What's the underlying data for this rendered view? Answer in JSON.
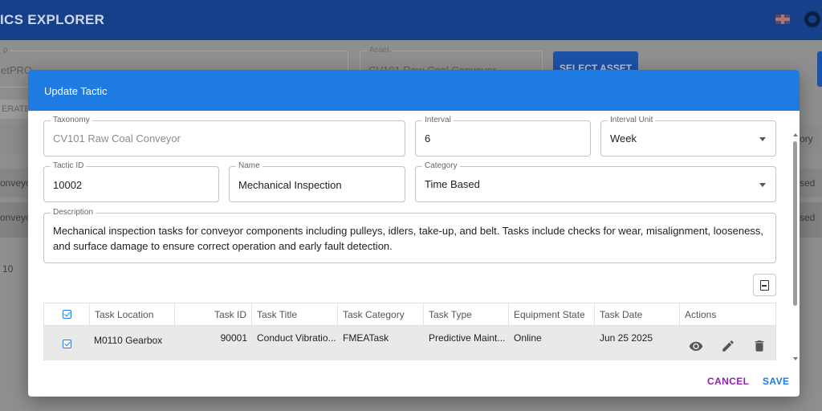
{
  "app": {
    "title": "ICS EXPLORER",
    "select_asset_label": "SELECT ASSET",
    "left_field_label": "p",
    "left_field_value": "etPRO",
    "asset_label": "Asset",
    "asset_value": "CV101 Raw Coal Conveyor",
    "generate_label": "ERATE",
    "bg_column_text": "ory",
    "bg_row1_left": "onveyo",
    "bg_row1_right": "sed",
    "bg_row2_left": "onveyo",
    "bg_row2_right": "sed",
    "bg_pager": "10"
  },
  "modal": {
    "title": "Update Tactic",
    "taxonomy": {
      "label": "Taxonomy",
      "value": "CV101 Raw Coal Conveyor"
    },
    "interval": {
      "label": "Interval",
      "value": "6"
    },
    "interval_unit": {
      "label": "Interval Unit",
      "value": "Week"
    },
    "tactic_id": {
      "label": "Tactic ID",
      "value": "10002"
    },
    "name": {
      "label": "Name",
      "value": "Mechanical Inspection"
    },
    "category": {
      "label": "Category",
      "value": "Time Based"
    },
    "description": {
      "label": "Description",
      "value": "Mechanical inspection tasks for conveyor components including pulleys, idlers, take-up, and belt. Tasks include checks for wear, misalignment, looseness, and surface damage to ensure correct operation and early fault detection."
    },
    "table": {
      "columns": [
        "Task Location",
        "Task ID",
        "Task Title",
        "Task Category",
        "Task Type",
        "Equipment State",
        "Task Date",
        "Actions"
      ],
      "rows": [
        {
          "task_location": "M0110 Gearbox",
          "task_id": "90001",
          "task_title": "Conduct Vibratio...",
          "task_category": "FMEATask",
          "task_type": "Predictive Maint...",
          "equipment_state": "Online",
          "task_date": "Jun 25 2025",
          "selected": true
        }
      ]
    },
    "cancel_label": "CANCEL",
    "save_label": "SAVE"
  },
  "colors": {
    "header_blue": "#1d7be1",
    "appbar_blue": "#16408a",
    "cancel_purple": "#8e24aa",
    "save_blue": "#1d7be1"
  },
  "icons": [
    "flag-icon",
    "settings-icon",
    "dropdown-caret-icon",
    "export-icon",
    "checkbox-icon",
    "view-icon",
    "edit-icon",
    "delete-icon"
  ]
}
